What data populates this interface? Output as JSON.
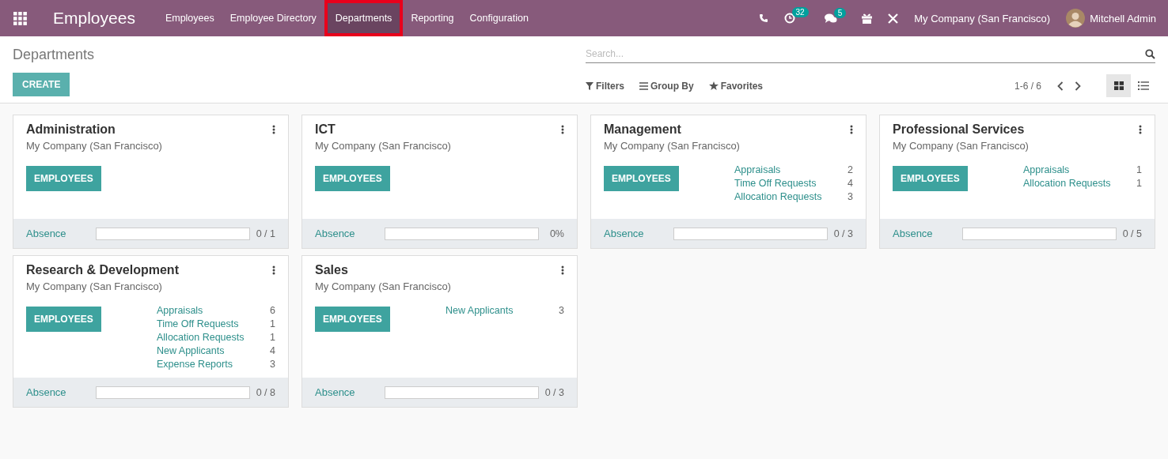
{
  "navbar": {
    "app_title": "Employees",
    "menu": [
      {
        "label": "Employees",
        "selected": false
      },
      {
        "label": "Employee Directory",
        "selected": false
      },
      {
        "label": "Departments",
        "selected": true
      },
      {
        "label": "Reporting",
        "selected": false
      },
      {
        "label": "Configuration",
        "selected": false
      }
    ],
    "activity_count": "32",
    "message_count": "5",
    "company": "My Company (San Francisco)",
    "user": "Mitchell Admin"
  },
  "control_panel": {
    "breadcrumb": "Departments",
    "create_button": "CREATE",
    "search": {
      "placeholder": "Search..."
    },
    "filters": "Filters",
    "group_by": "Group By",
    "favorites": "Favorites",
    "pager": "1-6 / 6",
    "views": [
      {
        "kind": "kanban",
        "selected": true
      },
      {
        "kind": "list",
        "selected": false
      }
    ]
  },
  "departments": [
    {
      "name": "Administration",
      "company": "My Company (San Francisco)",
      "button": "EMPLOYEES",
      "absence_label": "Absence",
      "level": 0,
      "absence_value": "0 / 1"
    },
    {
      "name": "ICT",
      "company": "My Company (San Francisco)",
      "button": "EMPLOYEES",
      "absence_label": "Absence",
      "level": 0,
      "absence_value": "0%"
    },
    {
      "name": "Management",
      "company": "My Company (San Francisco)",
      "button": "EMPLOYEES",
      "stats": [
        {
          "label": "Appraisals",
          "count": "2"
        },
        {
          "label": "Time Off Requests",
          "count": "4"
        },
        {
          "label": "Allocation Requests",
          "count": "3"
        }
      ],
      "absence_label": "Absence",
      "level": 0,
      "absence_value": "0 / 3"
    },
    {
      "name": "Professional Services",
      "company": "My Company (San Francisco)",
      "button": "EMPLOYEES",
      "stats": [
        {
          "label": "Appraisals",
          "count": "1"
        },
        {
          "label": "Allocation Requests",
          "count": "1"
        }
      ],
      "absence_label": "Absence",
      "level": 0,
      "absence_value": "0 / 5"
    },
    {
      "name": "Research & Development",
      "company": "My Company (San Francisco)",
      "button": "EMPLOYEES",
      "stats": [
        {
          "label": "Appraisals",
          "count": "6"
        },
        {
          "label": "Time Off Requests",
          "count": "1"
        },
        {
          "label": "Allocation Requests",
          "count": "1"
        },
        {
          "label": "New Applicants",
          "count": "4"
        },
        {
          "label": "Expense Reports",
          "count": "3"
        }
      ],
      "absence_label": "Absence",
      "level": 0,
      "absence_value": "0 / 8"
    },
    {
      "name": "Sales",
      "company": "My Company (San Francisco)",
      "button": "EMPLOYEES",
      "stats": [
        {
          "label": "New Applicants",
          "count": "3"
        }
      ],
      "absence_label": "Absence",
      "level": 0,
      "absence_value": "0 / 3"
    }
  ]
}
